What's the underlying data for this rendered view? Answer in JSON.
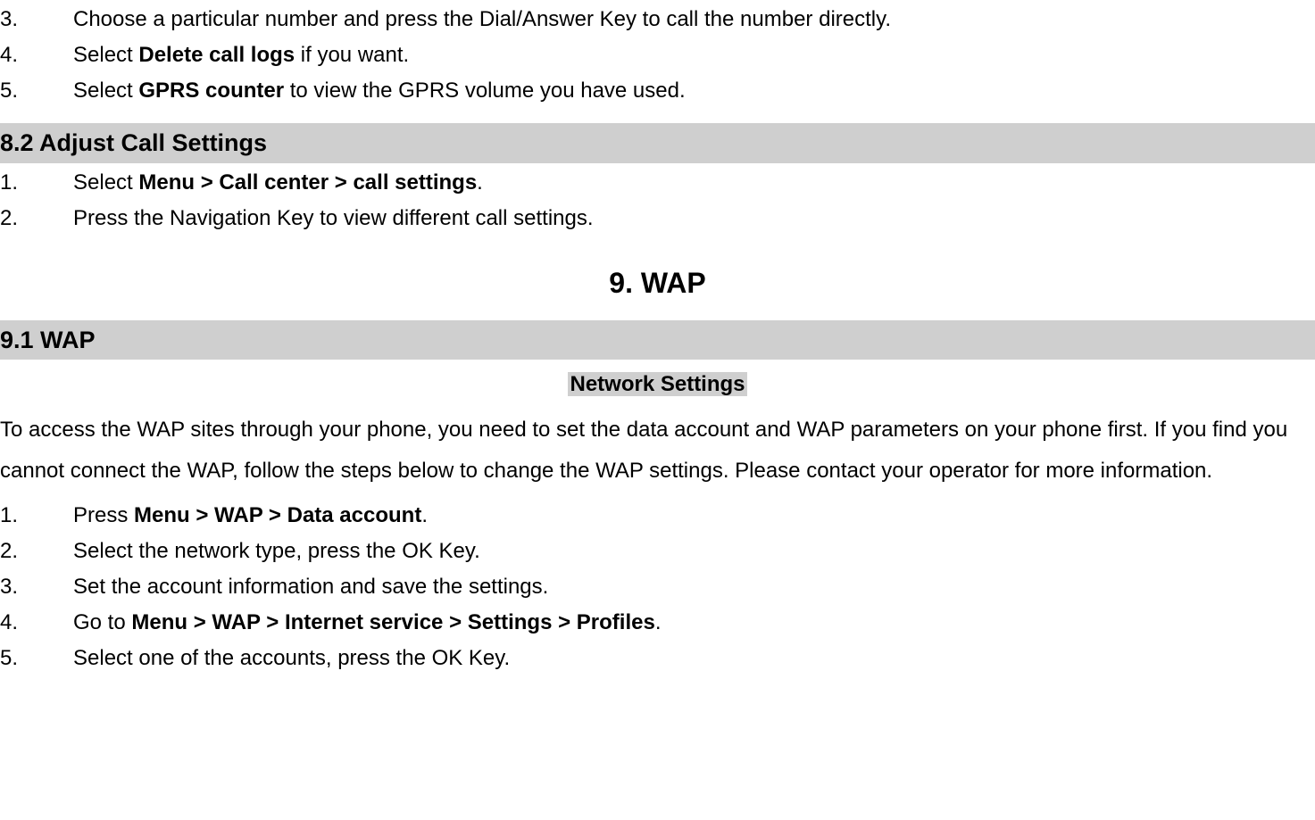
{
  "top_list": [
    {
      "n": "3.",
      "pre": "Choose a particular number and press the Dial/Answer Key to call the number directly.",
      "bold": "",
      "post": ""
    },
    {
      "n": "4.",
      "pre": "Select ",
      "bold": "Delete call logs",
      "post": " if you want."
    },
    {
      "n": "5.",
      "pre": "Select ",
      "bold": "GPRS counter",
      "post": " to view the GPRS volume you have used."
    }
  ],
  "section_82": "8.2  Adjust Call Settings",
  "list_82": [
    {
      "n": "1.",
      "pre": "Select ",
      "bold": "Menu > Call center > call settings",
      "post": "."
    },
    {
      "n": "2.",
      "pre": "Press the Navigation Key to view different call settings.",
      "bold": "",
      "post": ""
    }
  ],
  "chapter_9": "9.   WAP",
  "section_91": "9.1  WAP",
  "subhead_91": "Network Settings",
  "para_91": "To access the WAP sites through your phone, you need to set the data account and WAP parameters on your phone first. If you find you cannot connect the WAP, follow the steps below to change the WAP settings. Please contact your operator for more information.",
  "list_91": [
    {
      "n": "1.",
      "pre": "Press ",
      "bold": "Menu > WAP > Data account",
      "post": "."
    },
    {
      "n": "2.",
      "pre": "Select the network type, press the OK Key.",
      "bold": "",
      "post": ""
    },
    {
      "n": "3.",
      "pre": "Set the account information and save the settings.",
      "bold": "",
      "post": ""
    },
    {
      "n": "4.",
      "pre": "Go to ",
      "bold": "Menu > WAP > Internet service > Settings > Profiles",
      "post": "."
    },
    {
      "n": "5.",
      "pre": "Select one of the accounts, press the OK Key.",
      "bold": "",
      "post": ""
    }
  ]
}
